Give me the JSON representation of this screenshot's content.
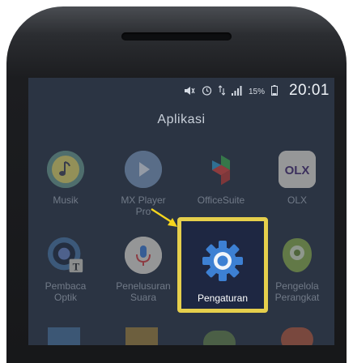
{
  "status_bar": {
    "battery_percent": "15%",
    "time": "20:01",
    "icons": [
      "mute-icon",
      "alarm-icon",
      "data-icon",
      "signal-icon",
      "battery-icon"
    ]
  },
  "drawer": {
    "title": "Aplikasi"
  },
  "apps": {
    "musik": "Musik",
    "mx_player_pro": "MX Player\nPro",
    "officesuite": "OfficeSuite",
    "olx": "OLX",
    "pembaca_optik": "Pembaca\nOptik",
    "penelusuran_suara": "Penelusuran\nSuara",
    "pengaturan": "Pengaturan",
    "pengelola_perangkat": "Pengelola\nPerangkat",
    "olx_badge": "OLX"
  },
  "colors": {
    "highlight_border": "#e6cf4c",
    "arrow": "#f5d51e",
    "settings_blue": "#2f6fb7"
  }
}
